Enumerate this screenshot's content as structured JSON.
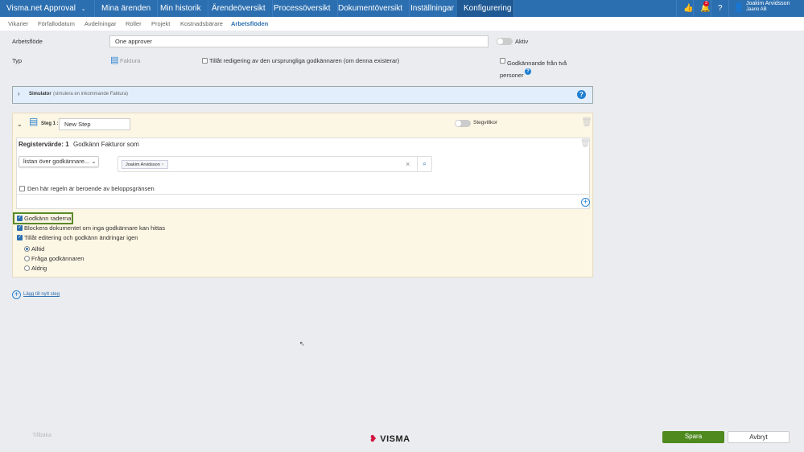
{
  "nav": {
    "app": "Visma.net Approval",
    "items": [
      "Mina ärenden",
      "Min historik",
      "Ärendeöversikt",
      "Processöversikt",
      "Dokumentöversikt",
      "Inställningar",
      "Konfigurering"
    ],
    "active": "Konfigurering",
    "notification_count": "3",
    "user_name": "Joakim Arvidsson",
    "user_company": "Jaario AB"
  },
  "subnav": {
    "items": [
      "Vikarier",
      "Förfallodatum",
      "Avdelningar",
      "Roller",
      "Projekt",
      "Kostnadsbärare",
      "Arbetsflöden"
    ],
    "active": "Arbetsflöden"
  },
  "form": {
    "workflow_label": "Arbetsflöde",
    "workflow_value": "One approver",
    "active_label": "Aktiv",
    "type_label": "Typ",
    "type_value": "Faktura",
    "allow_edit_label": "Tillåt redigering av den ursprungliga godkännaren (om denna existerar)",
    "two_person_label": "Godkännande från två personer"
  },
  "simulator": {
    "title": "Simulator",
    "subtitle": "(simulera en inkommande Faktura)"
  },
  "step": {
    "label": "Steg 1 :",
    "name": "New Step",
    "conditions_label": "Stegvillkor",
    "rule": {
      "register_label": "Registervärde: 1",
      "approve_label": "Godkänn Fakturor som",
      "dropdown": "listan över godkännare...",
      "approver_tag": "Joakim Arvidsson",
      "amount_limit_label": "Den här regeln är beroende av beloppsgränsen"
    },
    "options": [
      {
        "label": "Godkänn raderna",
        "checked": true
      },
      {
        "label": "Blockera dokumentet om inga godkännare kan hittas",
        "checked": true
      },
      {
        "label": "Tillåt editering och godkänn ändringar igen",
        "checked": true
      }
    ],
    "radios": [
      {
        "label": "Alltid",
        "selected": true
      },
      {
        "label": "Fråga godkännaren",
        "selected": false
      },
      {
        "label": "Aldrig",
        "selected": false
      }
    ]
  },
  "add_step": "Lägg till nytt steg",
  "footer": {
    "back": "Tillbaka",
    "logo": "VISMA",
    "save": "Spara",
    "cancel": "Avbryt"
  },
  "colors": {
    "nav": "#2c6fb0",
    "save": "#4e8a1e",
    "highlight": "#5a8a2a"
  }
}
